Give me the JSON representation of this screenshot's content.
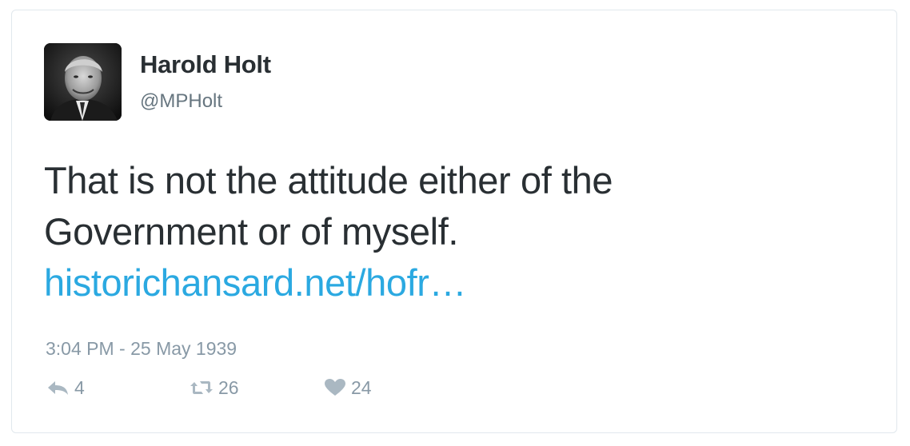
{
  "user": {
    "name": "Harold Holt",
    "handle": "@MPHolt"
  },
  "tweet": {
    "line1": "That is not the attitude either of the",
    "line2": "Government or of myself.",
    "link": "historichansard.net/hofr…",
    "timestamp": "3:04 PM - 25 May 1939"
  },
  "actions": {
    "replies": "4",
    "retweets": "26",
    "likes": "24"
  },
  "colors": {
    "text": "#292f33",
    "secondary": "#66757f",
    "muted": "#8899a6",
    "link": "#2ba9e1",
    "border": "#e1e8ed"
  },
  "icons": {
    "reply": "reply-icon",
    "retweet": "retweet-icon",
    "like": "heart-icon"
  }
}
